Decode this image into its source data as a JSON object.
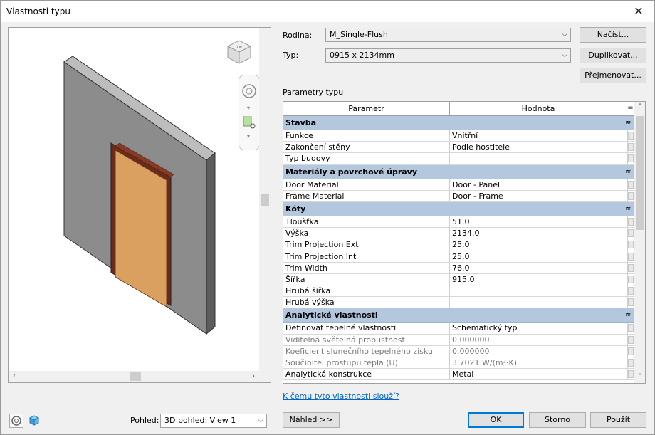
{
  "window": {
    "title": "Vlastnosti typu",
    "close_glyph": "✕"
  },
  "preview": {
    "view_label": "Pohled:",
    "view_value": "3D pohled: View 1",
    "preview_button": "Náhled >>",
    "viewcube_text": "TOP"
  },
  "form": {
    "family_label": "Rodina:",
    "family_value": "M_Single-Flush",
    "type_label": "Typ:",
    "type_value": "0915 x 2134mm",
    "load_button": "Načíst...",
    "duplicate_button": "Duplikovat...",
    "rename_button": "Přejmenovat...",
    "params_caption": "Parametry typu"
  },
  "table": {
    "col_param": "Parametr",
    "col_value": "Hodnota",
    "col_eq": "=",
    "groups": [
      {
        "name": "Stavba",
        "rows": [
          {
            "p": "Funkce",
            "v": "Vnitřní"
          },
          {
            "p": "Zakončení stěny",
            "v": "Podle hostitele"
          },
          {
            "p": "Typ budovy",
            "v": ""
          }
        ]
      },
      {
        "name": "Materiály a povrchové úpravy",
        "rows": [
          {
            "p": "Door Material",
            "v": "Door - Panel"
          },
          {
            "p": "Frame Material",
            "v": "Door - Frame"
          }
        ]
      },
      {
        "name": "Kóty",
        "rows": [
          {
            "p": "Tloušťka",
            "v": "51.0"
          },
          {
            "p": "Výška",
            "v": "2134.0"
          },
          {
            "p": "Trim Projection Ext",
            "v": "25.0"
          },
          {
            "p": "Trim Projection Int",
            "v": "25.0"
          },
          {
            "p": "Trim Width",
            "v": "76.0"
          },
          {
            "p": "Šířka",
            "v": "915.0"
          },
          {
            "p": "Hrubá šířka",
            "v": ""
          },
          {
            "p": "Hrubá výška",
            "v": ""
          }
        ]
      },
      {
        "name": "Analytické vlastnosti",
        "rows": [
          {
            "p": "Definovat tepelné vlastnosti",
            "v": "Schematický typ"
          },
          {
            "p": "Viditelná světelná propustnost",
            "v": "0.000000",
            "grey": true
          },
          {
            "p": "Koeficient slunečního tepelného zisku",
            "v": "0.000000",
            "grey": true
          },
          {
            "p": "Součinitel prostupu tepla (U)",
            "v": "3.7021 W/(m²·K)",
            "grey": true
          },
          {
            "p": "Analytická konstrukce",
            "v": "Metal"
          }
        ]
      }
    ],
    "collapse_glyph": "≈"
  },
  "help_link": "K čemu tyto vlastnosti slouží?",
  "buttons": {
    "ok": "OK",
    "cancel": "Storno",
    "apply": "Použít"
  },
  "colors": {
    "accent": "#0078d7",
    "group_header": "#b3c7de",
    "wall": "#8c8c8c",
    "door": "#d9a060",
    "frame": "#6b2a1a"
  }
}
